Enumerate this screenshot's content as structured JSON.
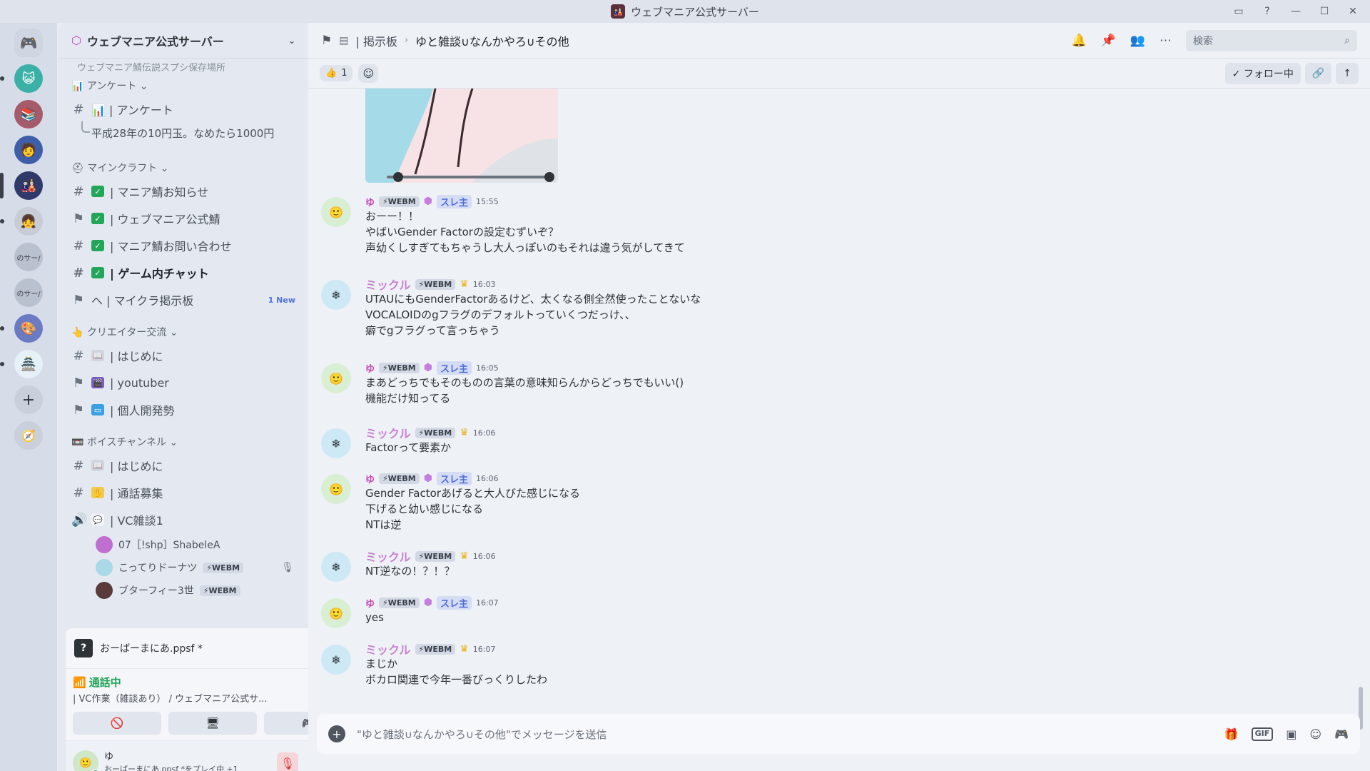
{
  "window": {
    "title": "ウェブマニア公式サーバー",
    "app_icon": "🎎",
    "controls": [
      "▭",
      "?",
      "—",
      "☐",
      "✕"
    ]
  },
  "rail": {
    "servers": [
      {
        "label": "",
        "color": "#5865f2",
        "glyph": "🎮"
      },
      {
        "label": "",
        "color": "#3bb0a6",
        "glyph": "😺"
      },
      {
        "label": "",
        "color": "#a65b6b",
        "glyph": "📚"
      },
      {
        "label": "",
        "color": "#3e5ea8",
        "glyph": "🧑"
      },
      {
        "label": "",
        "color": "#2f3a6b",
        "glyph": "🎎"
      },
      {
        "label": "",
        "color": "#c7ccd6",
        "glyph": "👧"
      },
      {
        "label": "のサー/",
        "color": "#b9c1cf",
        "glyph": ""
      },
      {
        "label": "のサー/",
        "color": "#b9c1cf",
        "glyph": ""
      },
      {
        "label": "",
        "color": "#6a7bc4",
        "glyph": "🎨"
      },
      {
        "label": "",
        "color": "#e6f0f7",
        "glyph": "🏯"
      }
    ],
    "add": "+",
    "explore": "🧭"
  },
  "sidebar": {
    "server_name": "ウェブマニア公式サーバー",
    "cut_top": "ウェブマニア鯖伝説スプシ保存場所",
    "cat_survey": "📊 アンケート ⌄",
    "ch_survey": "📊 | アンケート",
    "thread_survey": "平成28年の10円玉。なめたら1000円",
    "cat_mc": "⛑ マインクラフト ⌄",
    "ch_mc1": "| マニア鯖お知らせ",
    "ch_mc2": "| ウェブマニア公式鯖",
    "ch_mc3": "| マニア鯖お問い合わせ",
    "ch_mc4": "| ゲーム内チャット",
    "ch_mc5": "ヘ | マイクラ掲示板",
    "ch_mc5_badge": "1 New",
    "cat_creator": "👆 クリエイター交流 ⌄",
    "ch_cr1": "| はじめに",
    "ch_cr2": "| youtuber",
    "ch_cr3": "| 個人開発勢",
    "cat_voice": "📼 ボイスチャンネル ⌄",
    "ch_vo1": "| はじめに",
    "ch_vo2": "| 通話募集",
    "ch_vo3": "| VC雑談1",
    "vc_users": [
      {
        "name": "07［!shp］ShabeleA",
        "tag": ""
      },
      {
        "name": "こってりドーナツ",
        "tag": "⚡WEBM"
      },
      {
        "name": "ブターフィー3世",
        "tag": "⚡WEBM"
      }
    ]
  },
  "now_playing": {
    "label": "おーばーまにあ.ppsf *"
  },
  "voice_panel": {
    "status": "通話中",
    "channel": "| VC作業（雑談あり） / ウェブマニア公式サ..."
  },
  "user_panel": {
    "name": "ゆ",
    "activity": "おーばーまにあ.ppsf *をプレイ中 +1"
  },
  "topbar": {
    "crumb": "| 掲示板",
    "sep": "›",
    "thread": "ゆと雑談∪なんかやろ∪その他",
    "search_placeholder": "検索"
  },
  "reactbar": {
    "reaction_emoji": "👍",
    "reaction_count": "1",
    "follow": "✓ フォロー中"
  },
  "messages": [
    {
      "user": "ゆ",
      "kind": "yu",
      "tag": "⚡WEBM",
      "op": "スレ主",
      "time": "15:55",
      "lines": [
        "おーー！！",
        "やばいGender Factorの設定むずいぞ？",
        "声幼くしすぎてもちゃうし大人っぽいのもそれは違う気がしてきて"
      ]
    },
    {
      "user": "ミックル",
      "kind": "mk",
      "tag": "⚡WEBM",
      "op": "",
      "time": "16:03",
      "lines": [
        "UTAUにもGenderFactorあるけど、太くなる側全然使ったことないな",
        "VOCALOIDのgフラグのデフォルトっていくつだっけ、、",
        "癖でgフラグって言っちゃう"
      ]
    },
    {
      "user": "ゆ",
      "kind": "yu",
      "tag": "⚡WEBM",
      "op": "スレ主",
      "time": "16:05",
      "lines": [
        "まあどっちでもそのものの言葉の意味知らんからどっちでもいい()",
        "機能だけ知ってる"
      ]
    },
    {
      "user": "ミックル",
      "kind": "mk",
      "tag": "⚡WEBM",
      "op": "",
      "time": "16:06",
      "lines": [
        "Factorって要素か"
      ]
    },
    {
      "user": "ゆ",
      "kind": "yu",
      "tag": "⚡WEBM",
      "op": "スレ主",
      "time": "16:06",
      "lines": [
        "Gender Factorあげると大人びた感じになる",
        "下げると幼い感じになる",
        "NTは逆"
      ]
    },
    {
      "user": "ミックル",
      "kind": "mk",
      "tag": "⚡WEBM",
      "op": "",
      "time": "16:06",
      "lines": [
        "NT逆なの！？！？"
      ]
    },
    {
      "user": "ゆ",
      "kind": "yu",
      "tag": "⚡WEBM",
      "op": "スレ主",
      "time": "16:07",
      "lines": [
        "yes"
      ]
    },
    {
      "user": "ミックル",
      "kind": "mk",
      "tag": "⚡WEBM",
      "op": "",
      "time": "16:07",
      "lines": [
        "まじか",
        "ボカロ関連で今年一番びっくりしたわ"
      ]
    }
  ],
  "composer": {
    "placeholder": "\"ゆと雑談∪なんかやろ∪その他\"でメッセージを送信"
  }
}
